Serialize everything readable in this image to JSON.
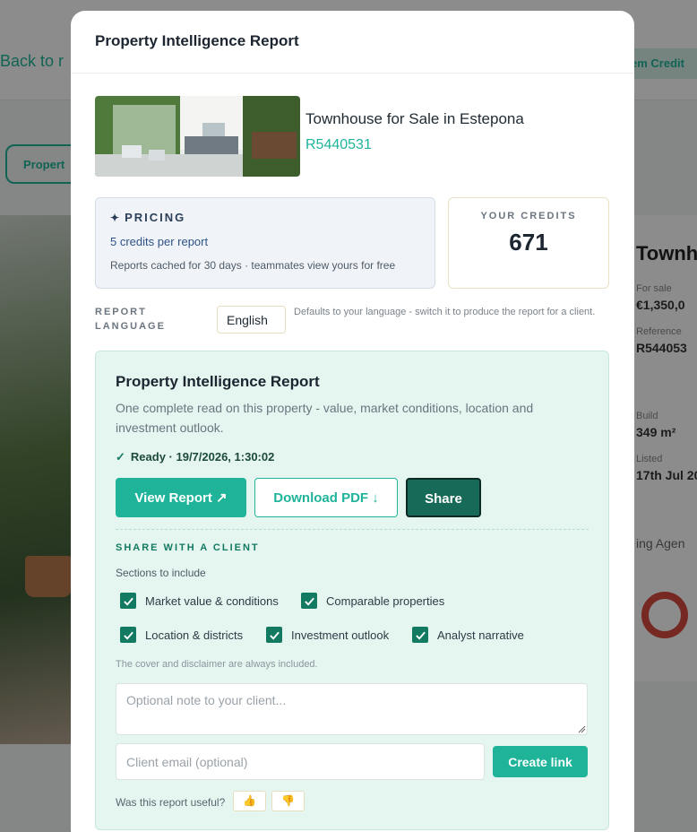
{
  "background": {
    "back_link": "Back to r",
    "credits_chip": "em Credit",
    "pill": "Propert",
    "card_title": "Townh",
    "for_sale_label": "For sale",
    "price": "€1,350,0",
    "reference_label": "Reference",
    "reference": "R544053",
    "build_label": "Build",
    "build_value": "349 m²",
    "listed_label": "Listed",
    "listed_value": "17th Jul 20",
    "agency": "ing Agen"
  },
  "modal": {
    "title": "Property Intelligence Report",
    "listing": {
      "name": "Townhouse for Sale in Estepona",
      "reference": "R5440531"
    },
    "pricing": {
      "heading": "PRICING",
      "rate": "5 credits per report",
      "note": "Reports cached for 30 days · teammates view yours for free"
    },
    "credits": {
      "label": "YOUR CREDITS",
      "value": "671"
    },
    "language": {
      "label": "REPORT LANGUAGE",
      "selected": "English",
      "hint": "Defaults to your language - switch it to produce the report for a client."
    },
    "report": {
      "title": "Property Intelligence Report",
      "description": "One complete read on this property - value, market conditions, location and investment outlook.",
      "status": "Ready · 19/7/2026, 1:30:02",
      "view_label": "View Report ↗",
      "pdf_label": "Download PDF ↓",
      "share_label": "Share"
    },
    "share": {
      "heading": "SHARE WITH A CLIENT",
      "sections_label": "Sections to include",
      "sections": [
        {
          "label": "Market value & conditions",
          "checked": true
        },
        {
          "label": "Comparable properties",
          "checked": true
        },
        {
          "label": "Location & districts",
          "checked": true
        },
        {
          "label": "Investment outlook",
          "checked": true
        },
        {
          "label": "Analyst narrative",
          "checked": true
        }
      ],
      "always_note": "The cover and disclaimer are always included.",
      "note_placeholder": "Optional note to your client...",
      "email_placeholder": "Client email (optional)",
      "create_label": "Create link",
      "useful_question": "Was this report useful?",
      "thumbs_up": "👍",
      "thumbs_down": "👎"
    }
  },
  "colors": {
    "accent": "#1fb49a",
    "accent_dark": "#176a57",
    "card_bg": "#e5f5f0",
    "pricing_bg": "#f0f4f9"
  }
}
